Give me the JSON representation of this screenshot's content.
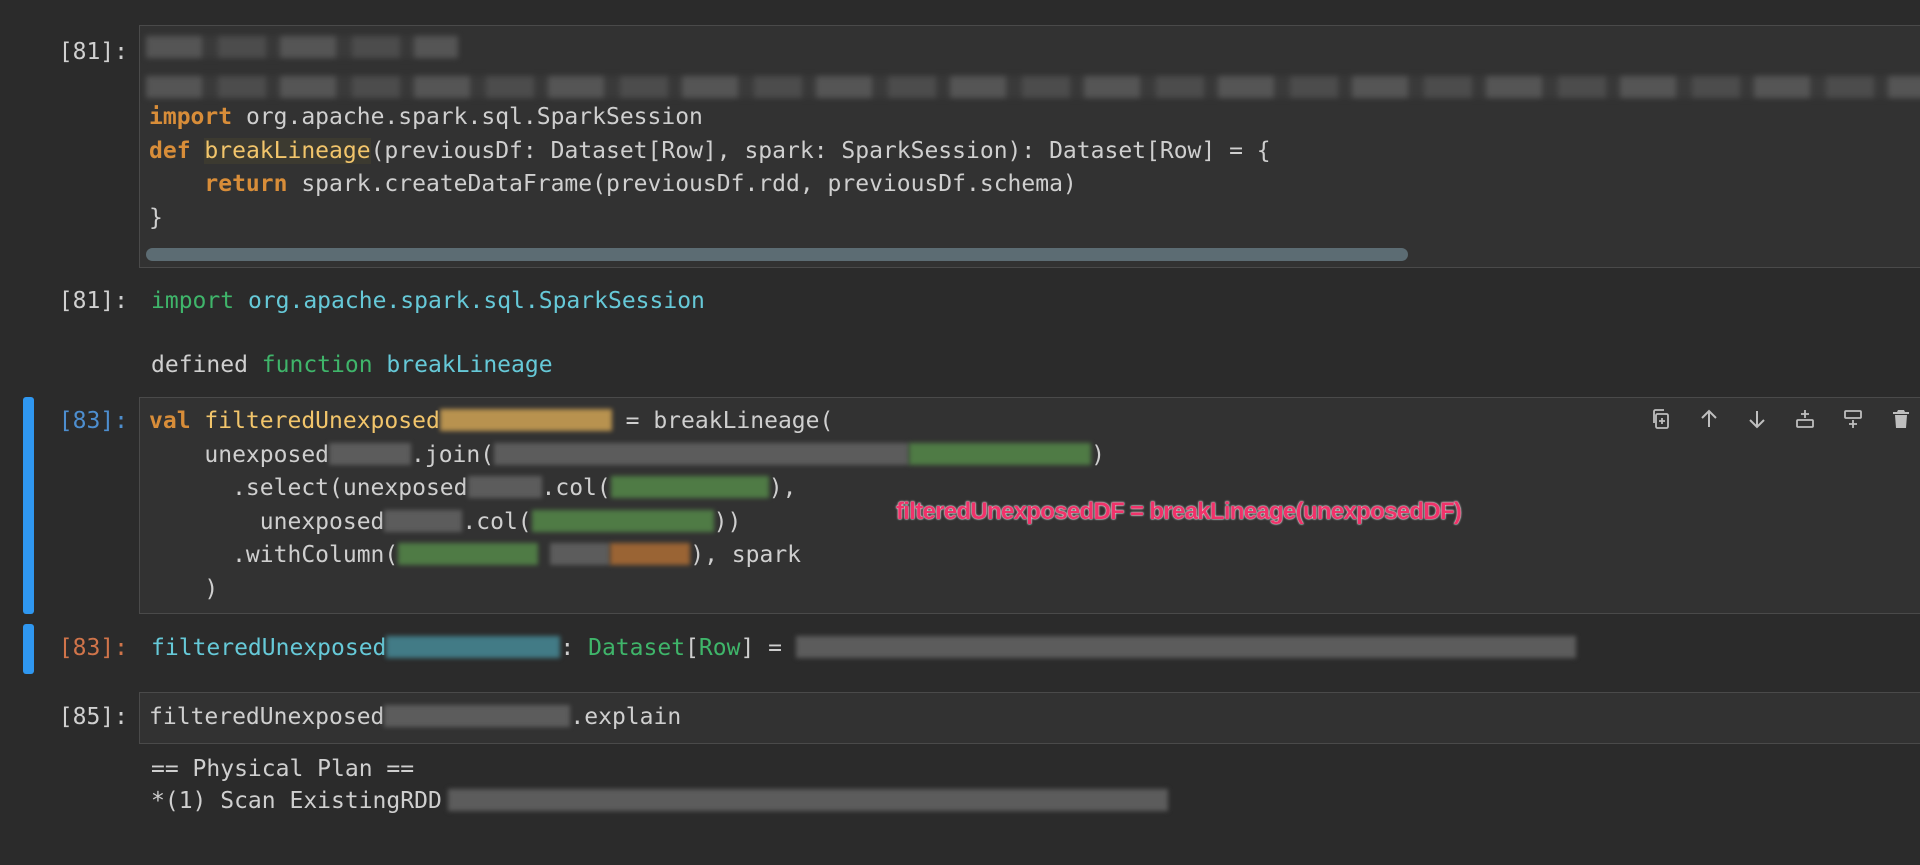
{
  "cells": {
    "c1": {
      "in_prompt": "[81]:",
      "code": {
        "import_kw": "import",
        "import_path": " org.apache.spark.sql.SparkSession",
        "def_kw": "def",
        "fn_name": "breakLineage",
        "sig": "(previousDf: Dataset[Row], spark: SparkSession): Dataset[Row] = {",
        "indent": "    ",
        "return_kw": "return",
        "return_expr": " spark.createDataFrame(previousDf.rdd, previousDf.schema)",
        "close": "}"
      },
      "out_prompt": "[81]:",
      "out": {
        "import_kw": "import",
        "import_path": " org.apache.spark.sql.SparkSession",
        "defined": "defined ",
        "function_kw": "function",
        "fn_name": " breakLineage"
      }
    },
    "c2": {
      "in_prompt": "[83]:",
      "code": {
        "val_kw": "val",
        "var_name": " filteredUnexposed",
        "assign": " = breakLineage(",
        "l2a": "    unexposed",
        "l2b": ".join(",
        "l2c": ")",
        "l3a": "      .select(unexposed",
        "l3b": ".col(",
        "l3c": "),",
        "l4a": "        unexposed",
        "l4b": ".col(",
        "l4c": "))",
        "l5a": "      .withColumn(",
        "l5b": "), spark",
        "l6": "    )"
      },
      "out_prompt": "[83]:",
      "out": {
        "name": "filteredUnexposed",
        "colon": ": ",
        "type_kw": "Dataset",
        "lbr": "[",
        "type_arg": "Row",
        "rbr": "]",
        "eq": " = "
      }
    },
    "c3": {
      "in_prompt": "[85]:",
      "code": {
        "a": "filteredUnexposed",
        "b": ".explain"
      },
      "out": {
        "line1": "== Physical Plan ==",
        "line2": "*(1) Scan ExistingRDD"
      }
    }
  },
  "annotation": "filteredUnexposedDF = breakLineage(unexposedDF)",
  "toolbar": {
    "icons": [
      "duplicate-icon",
      "move-up-icon",
      "move-down-icon",
      "insert-above-icon",
      "insert-below-icon",
      "delete-icon"
    ]
  },
  "colors": {
    "background": "#2b2b2b",
    "cell_bg": "#323232",
    "keyword": "#d88d39",
    "function_name": "#f2c56b",
    "output_green": "#3fb56a",
    "output_teal": "#66c9d8",
    "active_bar": "#2f97f0",
    "annotation": "#f0326a"
  }
}
